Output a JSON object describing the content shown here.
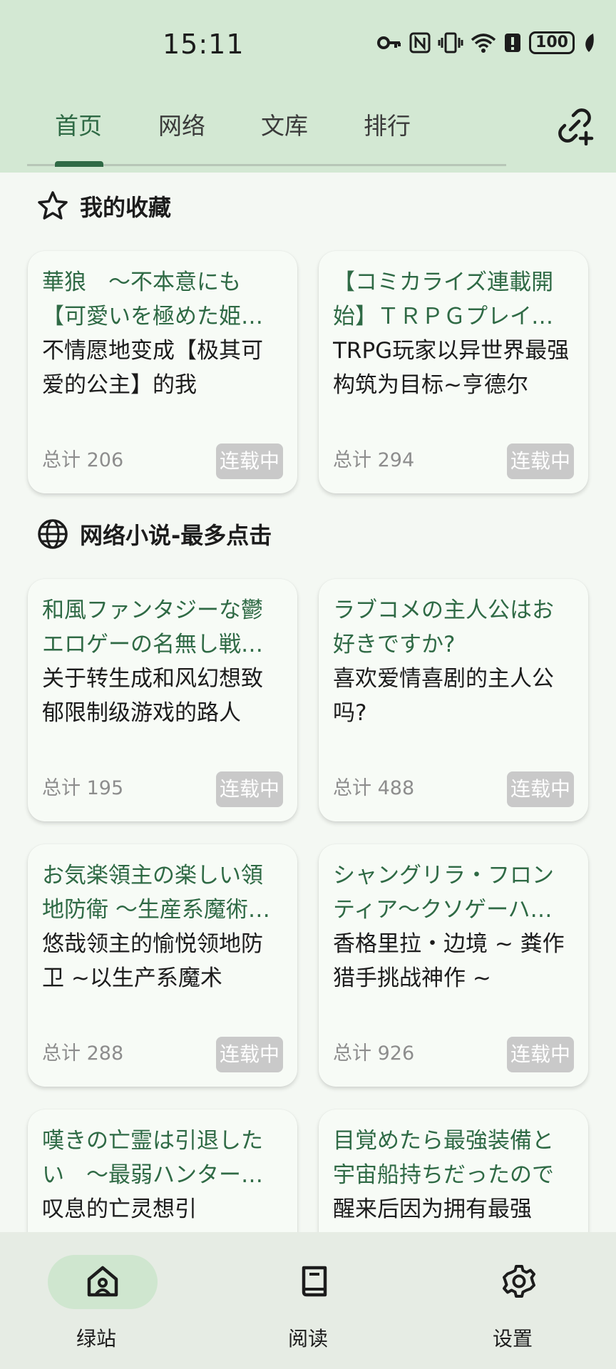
{
  "status_bar": {
    "time": "15:11",
    "battery": "100",
    "icons": [
      "key-icon",
      "nfc-icon",
      "vibrate-icon",
      "wifi-icon",
      "alert-icon",
      "battery-icon",
      "leaf-icon"
    ]
  },
  "tabs": [
    {
      "label": "首页",
      "active": true
    },
    {
      "label": "网络",
      "active": false
    },
    {
      "label": "文库",
      "active": false
    },
    {
      "label": "排行",
      "active": false
    }
  ],
  "sections": {
    "favorites": {
      "title": "我的收藏",
      "icon": "star-icon"
    },
    "web_novels": {
      "title": "网络小说-最多点击",
      "icon": "globe-icon"
    }
  },
  "favorites": [
    {
      "title": "華狼　〜不本意にも【可愛いを極めた姫君】になってしまった俺",
      "subtitle": "不情愿地变成【极其可爱的公主】的我",
      "count": "总计 206",
      "status": "连载中"
    },
    {
      "title": "【コミカライズ連載開始】ＴＲＰＧプレイヤーが異世界で最強ビルドを目指す",
      "subtitle": "TRPG玩家以异世界最强构筑为目标~亨德尔",
      "count": "总计 294",
      "status": "连载中"
    }
  ],
  "web_novels": [
    {
      "title": "和風ファンタジーな鬱エロゲーの名無し戦闘員に転生したんだが",
      "subtitle": "关于转生成和风幻想致郁限制级游戏的路人",
      "count": "总计 195",
      "status": "连载中"
    },
    {
      "title": "ラブコメの主人公はお好きですか?",
      "subtitle": "喜欢爱情喜剧的主人公吗?",
      "count": "总计 488",
      "status": "连载中"
    },
    {
      "title": "お気楽領主の楽しい領地防衛 〜生産系魔術で名もなき村を最強の城塞都市に〜",
      "subtitle": "悠哉领主的愉悦领地防卫 ~以生产系魔术",
      "count": "总计 288",
      "status": "连载中"
    },
    {
      "title": "シャングリラ・フロンティア〜クソゲーハンター、神ゲーに挑まんとす〜",
      "subtitle": "香格里拉・边境 ~ 粪作猎手挑战神作 ~",
      "count": "总计 926",
      "status": "连载中"
    },
    {
      "title": "嘆きの亡霊は引退したい　〜最弱ハンターによる最強パーティ育成術〜",
      "subtitle": "叹息的亡灵想引",
      "count": "",
      "status": ""
    },
    {
      "title": "目覚めたら最強装備と宇宙船持ちだったので",
      "subtitle": "醒来后因为拥有最强",
      "count": "",
      "status": ""
    }
  ],
  "bottom_nav": [
    {
      "label": "绿站",
      "icon": "home-icon",
      "active": true
    },
    {
      "label": "阅读",
      "icon": "book-icon",
      "active": false
    },
    {
      "label": "设置",
      "icon": "gear-icon",
      "active": false
    }
  ],
  "colors": {
    "accent": "#2f6a45",
    "header_bg": "#d3e8d3",
    "page_bg": "#f4f8f3",
    "badge_bg": "#c9c9c9",
    "nav_bg": "#e6ece4"
  }
}
